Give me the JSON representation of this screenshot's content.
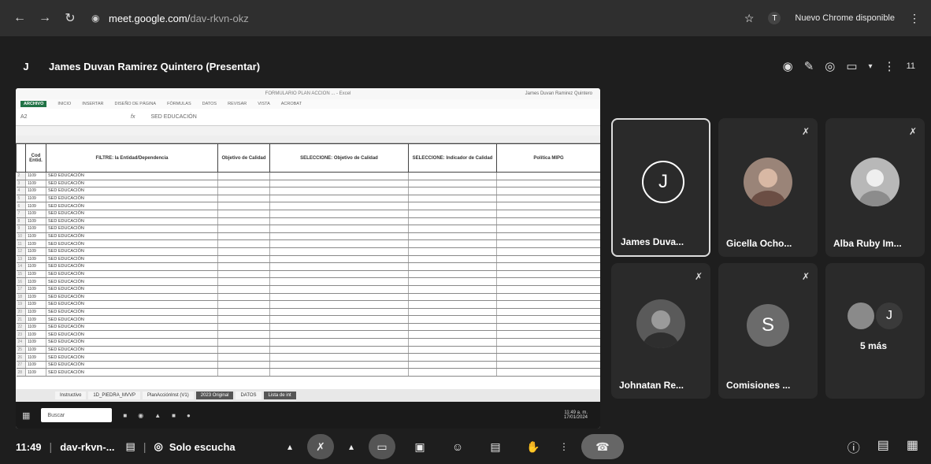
{
  "browser": {
    "url_domain": "meet.google.com/",
    "url_path": "dav-rkvn-okz",
    "profile": "T",
    "update_label": "Nuevo Chrome disponible"
  },
  "header": {
    "presenter_initial": "J",
    "presenter_title": "James Duvan Ramirez Quintero (Presentar)",
    "people_count": "11"
  },
  "shared_screen": {
    "file_title": "FORMULARIO PLAN ACCION ... - Excel",
    "account": "James Duvan Ramirez Quintero",
    "ribbon": [
      "ARCHIVO",
      "INICIO",
      "INSERTAR",
      "DISEÑO DE PÁGINA",
      "FÓRMULAS",
      "DATOS",
      "REVISAR",
      "VISTA",
      "ACROBAT"
    ],
    "name_box": "A2",
    "formula": "SED EDUCACIÓN",
    "columns": [
      "Cod Entid.",
      "FILTRE: la Entidad/Dependencia",
      "Objetivo de Calidad",
      "SELECCIONE: Objetivo de Calidad",
      "SELECCIONE: Indicador de Calidad",
      "Política MIPG"
    ],
    "rows": [
      {
        "n": "2",
        "code": "1109",
        "entity": "SED EDUCACIÓN"
      },
      {
        "n": "3",
        "code": "1109",
        "entity": "SED EDUCACIÓN"
      },
      {
        "n": "4",
        "code": "1109",
        "entity": "SED EDUCACIÓN"
      },
      {
        "n": "5",
        "code": "1109",
        "entity": "SED EDUCACIÓN"
      },
      {
        "n": "6",
        "code": "1109",
        "entity": "SED EDUCACIÓN"
      },
      {
        "n": "7",
        "code": "1109",
        "entity": "SED EDUCACIÓN"
      },
      {
        "n": "8",
        "code": "1109",
        "entity": "SED EDUCACIÓN"
      },
      {
        "n": "9",
        "code": "1109",
        "entity": "SED EDUCACIÓN"
      },
      {
        "n": "10",
        "code": "1109",
        "entity": "SED EDUCACIÓN"
      },
      {
        "n": "11",
        "code": "1109",
        "entity": "SED EDUCACIÓN"
      },
      {
        "n": "12",
        "code": "1109",
        "entity": "SED EDUCACIÓN"
      },
      {
        "n": "13",
        "code": "1109",
        "entity": "SED EDUCACIÓN"
      },
      {
        "n": "14",
        "code": "1109",
        "entity": "SED EDUCACIÓN"
      },
      {
        "n": "15",
        "code": "1109",
        "entity": "SED EDUCACIÓN"
      },
      {
        "n": "16",
        "code": "1109",
        "entity": "SED EDUCACIÓN"
      },
      {
        "n": "17",
        "code": "1109",
        "entity": "SED EDUCACIÓN"
      },
      {
        "n": "18",
        "code": "1109",
        "entity": "SED EDUCACIÓN"
      },
      {
        "n": "19",
        "code": "1109",
        "entity": "SED EDUCACIÓN"
      },
      {
        "n": "20",
        "code": "1109",
        "entity": "SED EDUCACIÓN"
      },
      {
        "n": "21",
        "code": "1109",
        "entity": "SED EDUCACIÓN"
      },
      {
        "n": "22",
        "code": "1109",
        "entity": "SED EDUCACIÓN"
      },
      {
        "n": "23",
        "code": "1109",
        "entity": "SED EDUCACIÓN"
      },
      {
        "n": "24",
        "code": "1109",
        "entity": "SED EDUCACIÓN"
      },
      {
        "n": "25",
        "code": "1109",
        "entity": "SED EDUCACIÓN"
      },
      {
        "n": "26",
        "code": "1109",
        "entity": "SED EDUCACIÓN"
      },
      {
        "n": "27",
        "code": "1109",
        "entity": "SED EDUCACIÓN"
      },
      {
        "n": "28",
        "code": "1109",
        "entity": "SED EDUCACIÓN"
      }
    ],
    "sheet_tabs": [
      "Instructivo",
      "1D_PIEDRA_MVVP",
      "PlanAcciónInst (V1)",
      "2023 Original",
      "DATOS",
      "Lista de int"
    ],
    "taskbar_search": "Buscar",
    "taskbar_time": "11:49 a. m.",
    "taskbar_date": "17/01/2024"
  },
  "participants": [
    {
      "name": "James Duva...",
      "initial": "J",
      "speaking": true
    },
    {
      "name": "Gicella Ocho...",
      "initial": "",
      "muted": true
    },
    {
      "name": "Alba Ruby Im...",
      "initial": "",
      "muted": true
    },
    {
      "name": "Johnatan Re...",
      "initial": "",
      "muted": true
    },
    {
      "name": "Comisiones ...",
      "initial": "S",
      "muted": true
    },
    {
      "name": "5 más",
      "initial": "J"
    }
  ],
  "controls": {
    "time": "11:49",
    "meeting_code": "dav-rkvn-...",
    "listen_mode": "Solo escucha"
  },
  "colors": {
    "background": "#1e1e1e",
    "tile": "#2a2a2a",
    "avatar_s": "#6b6b6b",
    "hangup": "#666666"
  }
}
